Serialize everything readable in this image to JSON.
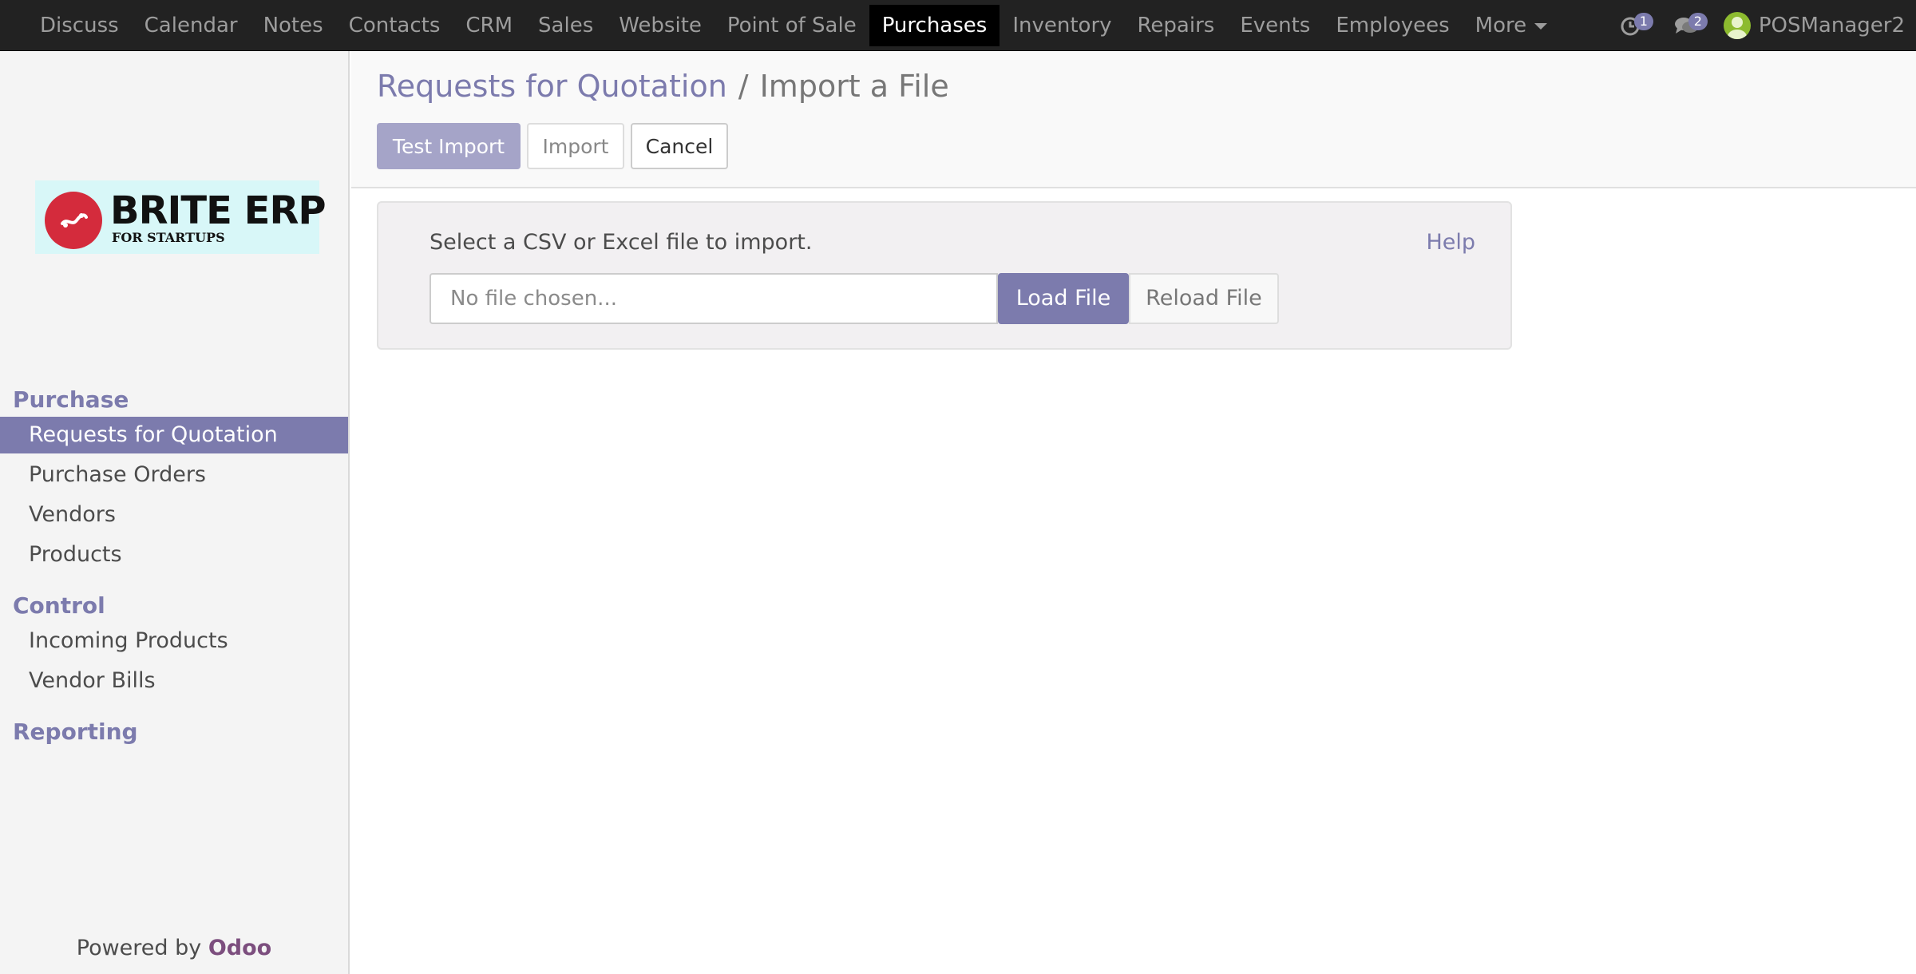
{
  "navbar": {
    "apps": [
      {
        "label": "Discuss",
        "active": false
      },
      {
        "label": "Calendar",
        "active": false
      },
      {
        "label": "Notes",
        "active": false
      },
      {
        "label": "Contacts",
        "active": false
      },
      {
        "label": "CRM",
        "active": false
      },
      {
        "label": "Sales",
        "active": false
      },
      {
        "label": "Website",
        "active": false
      },
      {
        "label": "Point of Sale",
        "active": false
      },
      {
        "label": "Purchases",
        "active": true
      },
      {
        "label": "Inventory",
        "active": false
      },
      {
        "label": "Repairs",
        "active": false
      },
      {
        "label": "Events",
        "active": false
      },
      {
        "label": "Employees",
        "active": false
      }
    ],
    "more_label": "More",
    "activity_count": "1",
    "messages_count": "2",
    "user_name": "POSManager2"
  },
  "logo": {
    "brand": "BRITE ERP",
    "tagline": "FOR STARTUPS"
  },
  "sidebar": {
    "sections": [
      {
        "title": "Purchase",
        "items": [
          "Requests for Quotation",
          "Purchase Orders",
          "Vendors",
          "Products"
        ]
      },
      {
        "title": "Control",
        "items": [
          "Incoming Products",
          "Vendor Bills"
        ]
      },
      {
        "title": "Reporting",
        "items": []
      }
    ],
    "active_item": "Requests for Quotation",
    "powered_by": "Powered by",
    "powered_brand": "Odoo"
  },
  "breadcrumb": {
    "parent": "Requests for Quotation",
    "separator": "/",
    "current": "Import a File"
  },
  "buttons": {
    "test_import": "Test Import",
    "import": "Import",
    "cancel": "Cancel"
  },
  "import_panel": {
    "label": "Select a CSV or Excel file to import.",
    "help": "Help",
    "file_placeholder": "No file chosen...",
    "load_file": "Load File",
    "reload_file": "Reload File"
  },
  "colors": {
    "accent": "#7c7bad",
    "navbar_bg": "#222222",
    "active_app_bg": "#000000"
  }
}
